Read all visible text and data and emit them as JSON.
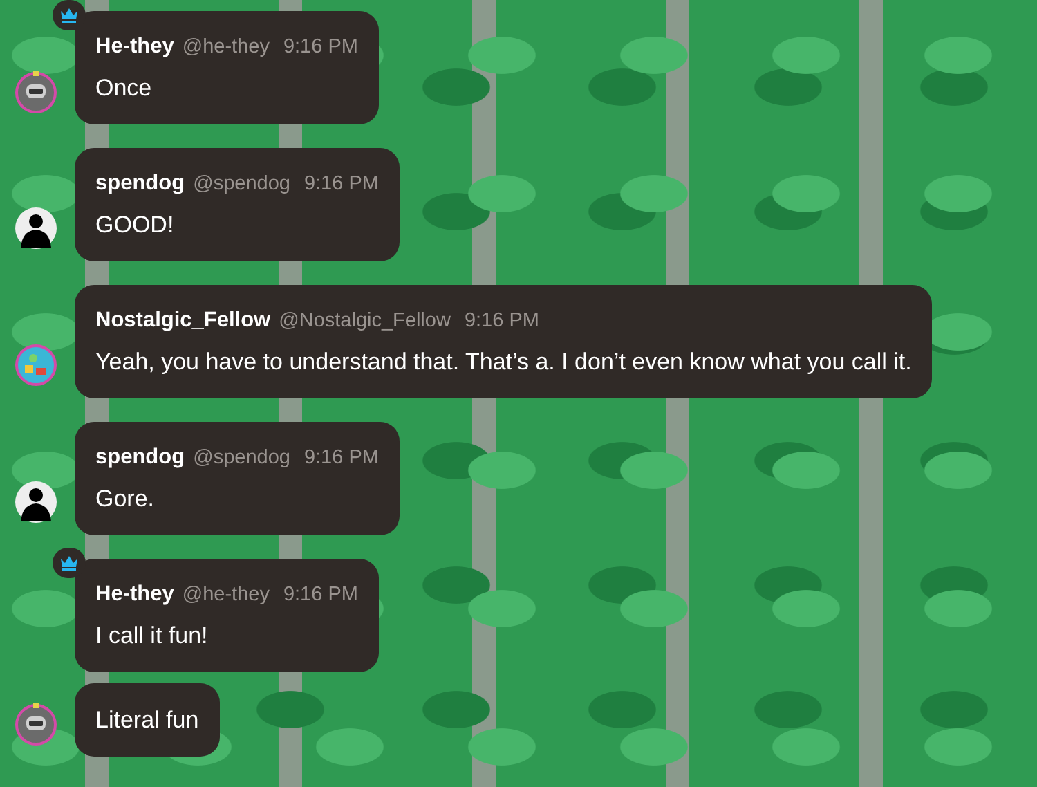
{
  "messages": [
    {
      "avatar": {
        "kind": "robot"
      },
      "crown": true,
      "bubbles": [
        {
          "name": "He-they",
          "handle": "@he-they",
          "time": "9:16 PM",
          "text": "Once"
        }
      ]
    },
    {
      "avatar": {
        "kind": "silhouette"
      },
      "crown": false,
      "bubbles": [
        {
          "name": "spendog",
          "handle": "@spendog",
          "time": "9:16 PM",
          "text": "GOOD!"
        }
      ]
    },
    {
      "avatar": {
        "kind": "colorful"
      },
      "crown": false,
      "bubbles": [
        {
          "name": "Nostalgic_Fellow",
          "handle": "@Nostalgic_Fellow",
          "time": "9:16 PM",
          "text": "Yeah, you have to understand that. That’s a. I don’t even know what you call it."
        }
      ]
    },
    {
      "avatar": {
        "kind": "silhouette"
      },
      "crown": false,
      "bubbles": [
        {
          "name": "spendog",
          "handle": "@spendog",
          "time": "9:16 PM",
          "text": "Gore."
        }
      ]
    },
    {
      "avatar": {
        "kind": "robot"
      },
      "crown": true,
      "bubbles": [
        {
          "name": "He-they",
          "handle": "@he-they",
          "time": "9:16 PM",
          "text": "I call it fun!"
        },
        {
          "text": "Literal fun"
        }
      ]
    }
  ]
}
